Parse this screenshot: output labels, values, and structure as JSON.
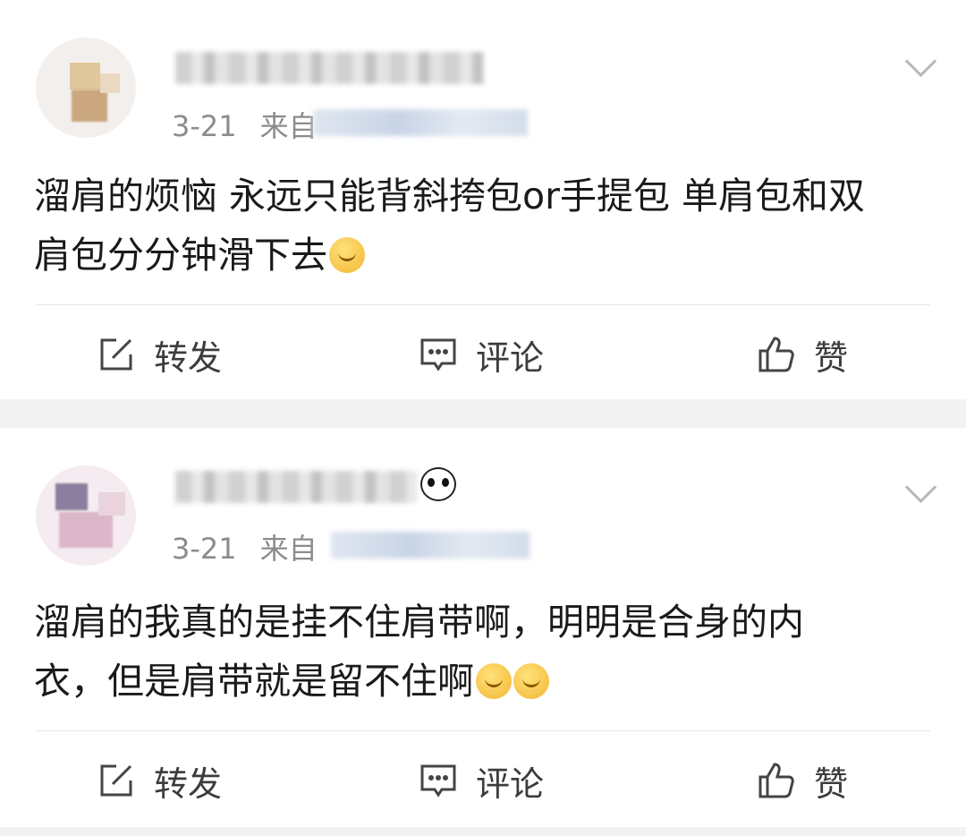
{
  "posts": [
    {
      "date": "3-21",
      "source_prefix": "来自",
      "text_line1": "溜肩的烦恼 永远只能背斜挎包or手提包 单肩包和双",
      "text_line2": "肩包分分钟滑下去",
      "actions": {
        "repost": "转发",
        "comment": "评论",
        "like": "赞"
      }
    },
    {
      "date": "3-21",
      "source_prefix": "来自",
      "text_line1": "溜肩的我真的是挂不住肩带啊，明明是合身的内",
      "text_line2": "衣，但是肩带就是留不住啊",
      "actions": {
        "repost": "转发",
        "comment": "评论",
        "like": "赞"
      }
    }
  ],
  "icons": {
    "repost": "edit-square-icon",
    "comment": "comment-bubble-icon",
    "like": "thumbs-up-icon",
    "menu": "chevron-down-icon"
  },
  "colors": {
    "background": "#f2f2f2",
    "card": "#ffffff",
    "meta_text": "#8c8c8c"
  }
}
